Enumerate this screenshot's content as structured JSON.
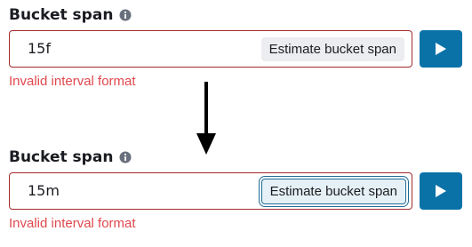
{
  "states": [
    {
      "label": "Bucket span",
      "value": "15f",
      "estimate_label": "Estimate bucket span",
      "error": "Invalid interval format"
    },
    {
      "label": "Bucket span",
      "value": "15m",
      "estimate_label": "Estimate bucket span",
      "error": "Invalid interval format"
    }
  ],
  "icons": {
    "info": "info-icon",
    "run": "play-icon",
    "transition": "arrow-down-icon"
  },
  "colors": {
    "invalid_border": "#a4292c",
    "error_text": "#e0484d",
    "run_button": "#0b72a8",
    "focus_ring": "#1f6b96"
  }
}
